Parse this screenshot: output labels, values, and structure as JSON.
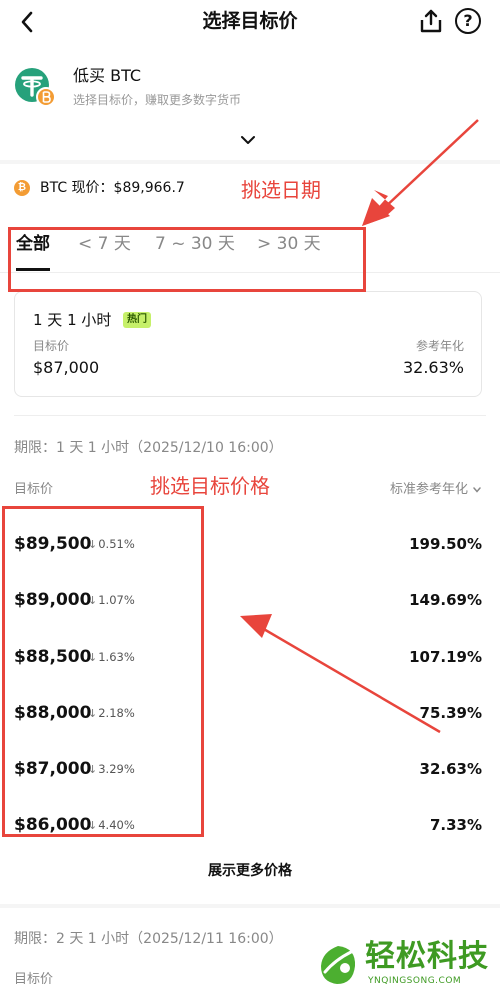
{
  "header": {
    "title": "选择目标价",
    "back_icon": "chevron-left-icon",
    "share_icon": "share-icon",
    "help_icon": "help-icon",
    "help_glyph": "?"
  },
  "product": {
    "name": "低买 BTC",
    "subtitle": "选择目标价，赚取更多数字货币",
    "logo_icon": "tether-btc-icon"
  },
  "btc": {
    "label": "BTC 现价：$89,966.7"
  },
  "annotations": {
    "date_note": "挑选日期",
    "price_note": "挑选目标价格",
    "color": "#e8453c"
  },
  "tabs": [
    {
      "label": "全部",
      "active": true
    },
    {
      "label": "< 7 天",
      "active": false
    },
    {
      "label": "7 ~ 30 天",
      "active": false
    },
    {
      "label": "> 30 天",
      "active": false
    }
  ],
  "card": {
    "duration": "1 天 1 小时",
    "badge": "热门",
    "target_label": "目标价",
    "target_value": "$87,000",
    "apy_label": "参考年化",
    "apy_value": "32.63%"
  },
  "section1": {
    "period": "期限：1 天 1 小时（2025/12/10 16:00）",
    "col_target": "目标价",
    "col_apy": "标准参考年化",
    "rows": [
      {
        "price": "$89,500",
        "change": "0.51%",
        "apy": "199.50%"
      },
      {
        "price": "$89,000",
        "change": "1.07%",
        "apy": "149.69%"
      },
      {
        "price": "$88,500",
        "change": "1.63%",
        "apy": "107.19%"
      },
      {
        "price": "$88,000",
        "change": "2.18%",
        "apy": "75.39%"
      },
      {
        "price": "$87,000",
        "change": "3.29%",
        "apy": "32.63%"
      },
      {
        "price": "$86,000",
        "change": "4.40%",
        "apy": "7.33%"
      }
    ],
    "show_more": "展示更多价格"
  },
  "section2": {
    "period": "期限：2 天 1 小时（2025/12/11 16:00）",
    "col_target": "目标价"
  },
  "watermark": {
    "text": "轻松科技",
    "sub": "YNQINGSONG.COM",
    "color": "#3e9a22"
  },
  "colors": {
    "hot_badge": "#c6f06a",
    "btc": "#f39c34"
  }
}
